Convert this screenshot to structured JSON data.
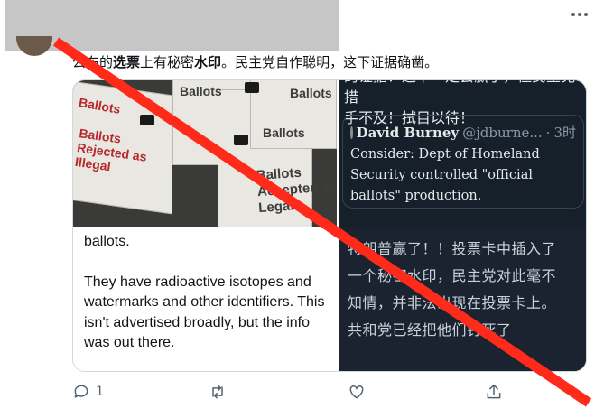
{
  "tweet": {
    "text_parts": {
      "p1": "公布的",
      "p2": "选票",
      "p3": "上有秘密",
      "p4": "水印",
      "p5": "。民主党自作聪明，这下证据确凿。"
    },
    "more_icon": "more-horizontal-icon"
  },
  "media": {
    "photo": {
      "labels": [
        "Ballots",
        "Ballots",
        "Ballots",
        "Ballots",
        "Ballots Rejected as Illegal",
        "Ballots Accepted as Legal"
      ],
      "label_color_rejected": "#b7282e"
    },
    "text_screenshot": {
      "line1": "ballots.",
      "para2": "They have radioactive isotopes and watermarks and other identifiers. This isn't advertised broadly, but the info was out there."
    },
    "dark_screenshot": {
      "top_lines": [
        "的证据！这下一定会赢了，但民主党措",
        "手不及！拭目以待！"
      ],
      "quote": {
        "name": "David Burney",
        "handle": "@jdburne...",
        "dot": "·",
        "time": "3时",
        "body": "Consider: Dept of Homeland Security controlled \"official ballots\" production."
      },
      "bottom_lines": [
        "特朗普赢了！！投票卡中插入了",
        "一个秘密水印，民主党对此毫不",
        "知情，并非法出现在投票卡上。",
        "共和党已经把他们钉死了"
      ]
    }
  },
  "actions": {
    "reply_count": "1",
    "retweet_count": "",
    "like_count": "",
    "icons": [
      "reply-icon",
      "retweet-icon",
      "like-icon",
      "share-icon"
    ]
  },
  "overlay": {
    "x_color": "#ff2a1a"
  }
}
